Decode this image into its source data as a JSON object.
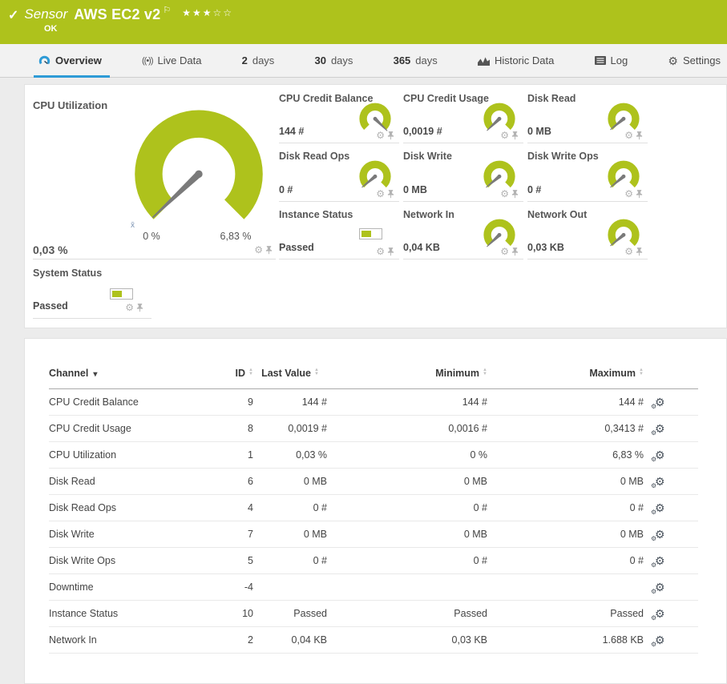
{
  "colors": {
    "brand_green": "#aec21c",
    "accent_blue": "#2e9bd6"
  },
  "icons": {
    "check": "✓",
    "flag": "⚐",
    "gear": "⚙",
    "sort_up": "▲",
    "sort_down": "▼",
    "caret_down": "▾",
    "live": "((•))"
  },
  "topbar": {
    "sensor_prefix": "Sensor",
    "title": "AWS EC2 v2",
    "rating_filled": "★★★",
    "rating_empty": "☆☆",
    "status": "OK"
  },
  "tabs": [
    {
      "label": "Overview"
    },
    {
      "label": "Live Data"
    },
    {
      "num": "2",
      "unit": "days"
    },
    {
      "num": "30",
      "unit": "days"
    },
    {
      "num": "365",
      "unit": "days"
    },
    {
      "label": "Historic Data"
    },
    {
      "label": "Log"
    },
    {
      "label": "Settings"
    }
  ],
  "overview": {
    "main_gauge": {
      "label": "CPU Utilization",
      "value": "0,03 %",
      "scale_min": "0 %",
      "scale_max": "6,83 %",
      "avg_marker": "x̄",
      "needle_fraction": 0.006
    },
    "tiles": [
      {
        "label": "CPU Credit Balance",
        "value": "144 #",
        "needle_fraction": 1
      },
      {
        "label": "CPU Credit Usage",
        "value": "0,0019 #",
        "needle_fraction": 0.005
      },
      {
        "label": "Disk Read",
        "value": "0 MB",
        "needle_fraction": 0.02
      },
      {
        "label": "Disk Read Ops",
        "value": "0 #",
        "needle_fraction": 0.02
      },
      {
        "label": "Disk Write",
        "value": "0 MB",
        "needle_fraction": 0.02
      },
      {
        "label": "Disk Write Ops",
        "value": "0 #",
        "needle_fraction": 0.02
      },
      {
        "label": "Instance Status",
        "value": "Passed",
        "widget": "status"
      },
      {
        "label": "Network In",
        "value": "0,04 KB",
        "needle_fraction": 0.006
      },
      {
        "label": "Network Out",
        "value": "0,03 KB",
        "needle_fraction": 0.02
      }
    ],
    "system_status": {
      "label": "System Status",
      "value": "Passed",
      "widget": "status"
    }
  },
  "table": {
    "columns": {
      "channel": "Channel",
      "id": "ID",
      "last": "Last Value",
      "min": "Minimum",
      "max": "Maximum"
    },
    "rows": [
      {
        "channel": "CPU Credit Balance",
        "id": "9",
        "last": "144 #",
        "min": "144 #",
        "max": "144 #"
      },
      {
        "channel": "CPU Credit Usage",
        "id": "8",
        "last": "0,0019 #",
        "min": "0,0016 #",
        "max": "0,3413 #"
      },
      {
        "channel": "CPU Utilization",
        "id": "1",
        "last": "0,03 %",
        "min": "0 %",
        "max": "6,83 %"
      },
      {
        "channel": "Disk Read",
        "id": "6",
        "last": "0 MB",
        "min": "0 MB",
        "max": "0 MB"
      },
      {
        "channel": "Disk Read Ops",
        "id": "4",
        "last": "0 #",
        "min": "0 #",
        "max": "0 #"
      },
      {
        "channel": "Disk Write",
        "id": "7",
        "last": "0 MB",
        "min": "0 MB",
        "max": "0 MB"
      },
      {
        "channel": "Disk Write Ops",
        "id": "5",
        "last": "0 #",
        "min": "0 #",
        "max": "0 #"
      },
      {
        "channel": "Downtime",
        "id": "-4",
        "last": "",
        "min": "",
        "max": ""
      },
      {
        "channel": "Instance Status",
        "id": "10",
        "last": "Passed",
        "min": "Passed",
        "max": "Passed"
      },
      {
        "channel": "Network In",
        "id": "2",
        "last": "0,04 KB",
        "min": "0,03 KB",
        "max": "1.688 KB"
      }
    ]
  }
}
